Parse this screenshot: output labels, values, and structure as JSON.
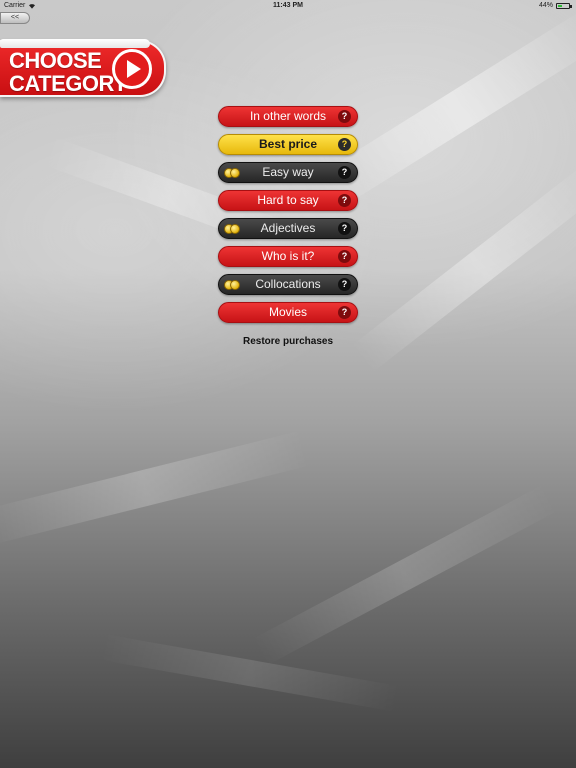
{
  "status_bar": {
    "carrier": "Carrier",
    "time": "11:43 PM",
    "battery_percent_label": "44%",
    "battery_level": 0.44,
    "wifi_icon": "wifi-icon",
    "battery_icon": "battery-icon"
  },
  "back_button": {
    "label": "<<"
  },
  "header": {
    "title_line1": "CHOOSE",
    "title_line2": "CATEGORY",
    "play_icon": "play-icon",
    "colors": {
      "banner": "#e21c1c",
      "text": "#ffffff"
    }
  },
  "categories": [
    {
      "label": "In other words",
      "style": "red",
      "locked": false,
      "help": "?"
    },
    {
      "label": "Best price",
      "style": "yellow",
      "locked": false,
      "help": "?"
    },
    {
      "label": "Easy way",
      "style": "dark",
      "locked": true,
      "help": "?"
    },
    {
      "label": "Hard to say",
      "style": "red",
      "locked": false,
      "help": "?"
    },
    {
      "label": "Adjectives",
      "style": "dark",
      "locked": true,
      "help": "?"
    },
    {
      "label": "Who is it?",
      "style": "red",
      "locked": false,
      "help": "?"
    },
    {
      "label": "Collocations",
      "style": "dark",
      "locked": true,
      "help": "?"
    },
    {
      "label": "Movies",
      "style": "red",
      "locked": false,
      "help": "?"
    }
  ],
  "restore": {
    "label": "Restore purchases"
  },
  "colors": {
    "red": "#d91f22",
    "yellow": "#f3cc22",
    "dark": "#333333",
    "coin": "#e3b30d"
  }
}
